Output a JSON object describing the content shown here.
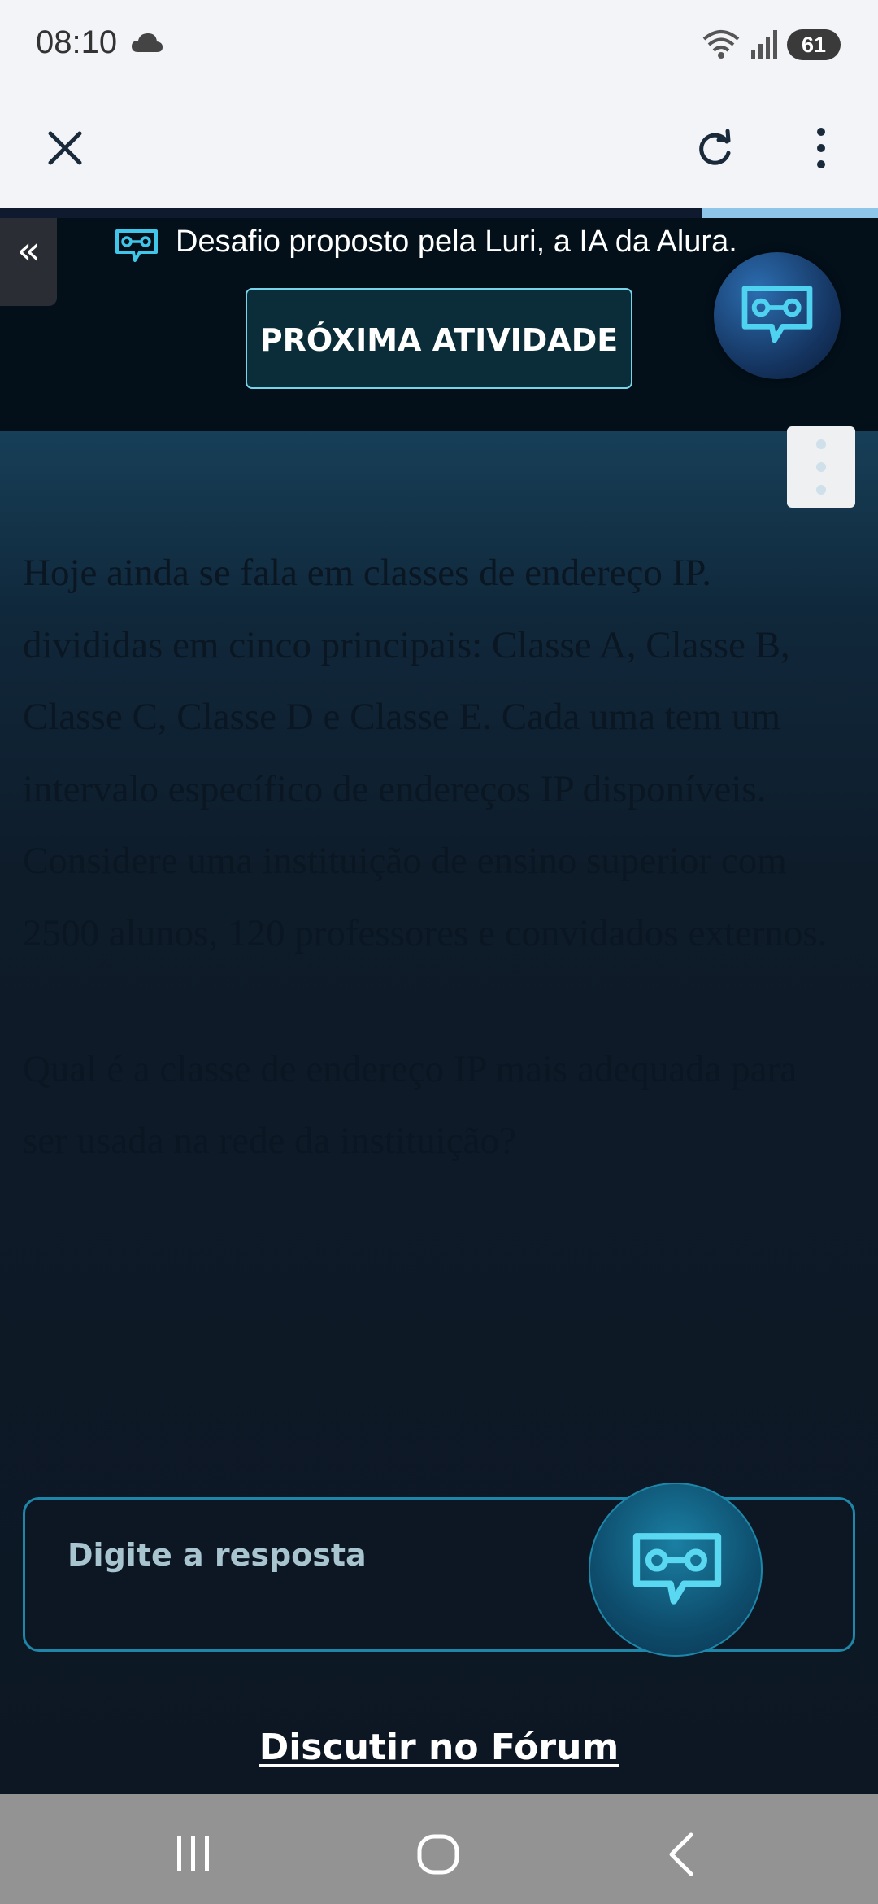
{
  "status_bar": {
    "time": "08:10",
    "battery": "61"
  },
  "toolbar": {
    "close_icon": "close-icon",
    "refresh_icon": "refresh-icon",
    "menu_icon": "more-vert-icon"
  },
  "page_progress": 0.2,
  "banner": {
    "collapse_label": "«",
    "luri_text": "Desafio proposto pela Luri, a IA da Alura.",
    "next_button": "PRÓXIMA ATIVIDADE"
  },
  "question": {
    "paragraphs": [
      "Hoje ainda se fala em classes de endereço IP. divididas em cinco principais: Classe A, Classe B, Classe C, Classe D e Classe E. Cada uma tem um intervalo específico de endereços IP disponíveis. Considere uma instituição de ensino superior com 2500 alunos, 120 professores e convidados externos.",
      "Qual é a classe de endereço IP mais adequada para ser usada na rede da instituição?"
    ]
  },
  "answer": {
    "placeholder": "Digite a resposta"
  },
  "forum_link": "Discutir no Fórum",
  "colors": {
    "accent": "#79d4ea",
    "answer_border": "#1e87a9",
    "banner_bg": "#03101a"
  }
}
